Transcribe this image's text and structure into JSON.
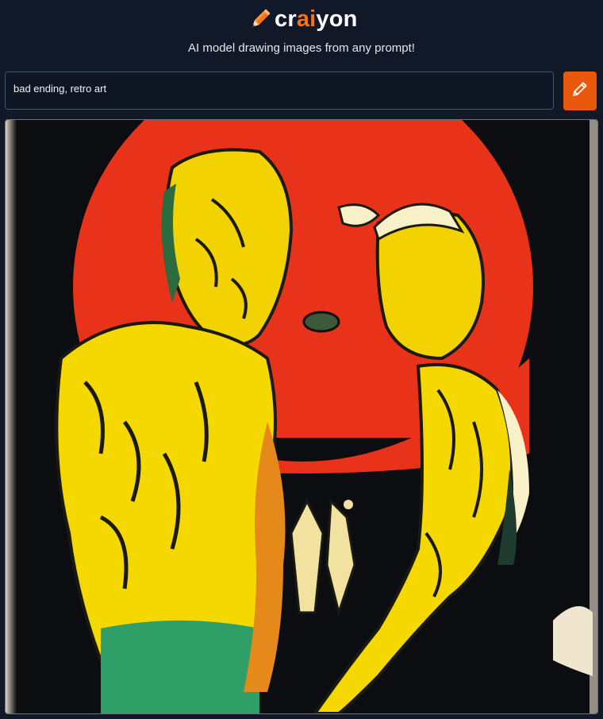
{
  "header": {
    "logo": {
      "icon": "pencil-icon",
      "text_before": "cr",
      "text_accent": "ai",
      "text_after": "yon",
      "accent_color": "#f97316"
    },
    "tagline": "AI model drawing images from any prompt!"
  },
  "prompt": {
    "value": "bad ending, retro art"
  },
  "draw_button": {
    "icon": "pencil-icon",
    "color": "#ea580c"
  },
  "result": {
    "image": "generated-artwork",
    "colors": {
      "background": "#0b0d11",
      "sun": "#e8321a",
      "figure": "#f5d800",
      "accent_green": "#2f9e67"
    }
  }
}
